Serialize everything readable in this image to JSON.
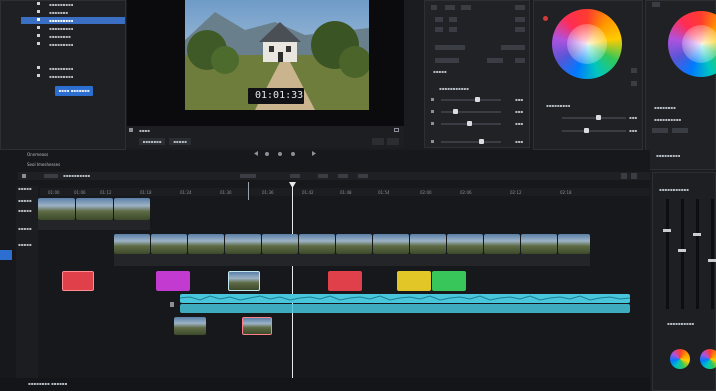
{
  "media_pool": {
    "items": [
      "▪▪▪▪▪▪▪▪▪",
      "▪▪▪▪▪▪▪",
      "▪▪▪▪▪▪▪▪▪",
      "▪▪▪▪▪▪▪▪▪",
      "▪▪▪▪▪▪▪▪",
      "▪▪▪▪▪▪▪▪▪",
      "▪▪▪▪▪▪▪▪▪",
      "▪▪▪▪▪▪▪▪▪"
    ],
    "selected_index": 1,
    "import_button": "▪▪▪▪ ▪▪▪▪▪▪▪"
  },
  "viewer": {
    "timecode": "01:01:33",
    "bottom_label": "▪▪▪▪",
    "btn_a": "▪▪▪▪▪▪▪",
    "btn_b": "▪▪▪▪▪"
  },
  "inspector": {
    "section1": "▪▪▪▪▪",
    "section2": "▪▪▪▪▪▪▪▪▪▪▪",
    "param_values": [
      "▪▪▪",
      "▪▪▪",
      "▪▪▪",
      "▪▪▪",
      "▪▪▪",
      "▪▪▪"
    ]
  },
  "color": {
    "title_a": "▪▪▪▪▪▪▪▪▪",
    "title_b": "▪▪▪▪▪▪▪▪",
    "effects_header": "▪▪▪▪▪▪▪▪▪▪",
    "mixer_header": "▪▪▪▪▪▪▪▪▪",
    "meter_label": "▪▪▪▪▪▪▪▪▪▪▪"
  },
  "timeline": {
    "tab_label": "Onnmeoss",
    "title": "Seol Imeshesses",
    "toolbar_label": "▪▪▪▪▪▪▪▪▪▪",
    "track_labels": [
      "▪▪▪▪▪",
      "▪▪▪▪▪",
      "▪▪▪▪▪",
      "▪▪▪▪▪",
      "▪▪▪▪▪"
    ],
    "ruler_marks": [
      "01:00",
      "01:06",
      "01:12",
      "01:18",
      "01:24",
      "01:30",
      "01:36",
      "01:42",
      "01:48",
      "01:54",
      "02:00",
      "02:06",
      "02:12",
      "02:18"
    ],
    "status": "▪▪▪▪▪▪▪▪ ▪▪▪▪▪▪"
  },
  "colors": {
    "accent": "#2d6fd0",
    "audio_clip": "#47c6dc",
    "clip_magenta": "#c23ad0",
    "clip_red": "#e0404a",
    "clip_yellow": "#e2c627",
    "clip_green": "#38c65a"
  }
}
